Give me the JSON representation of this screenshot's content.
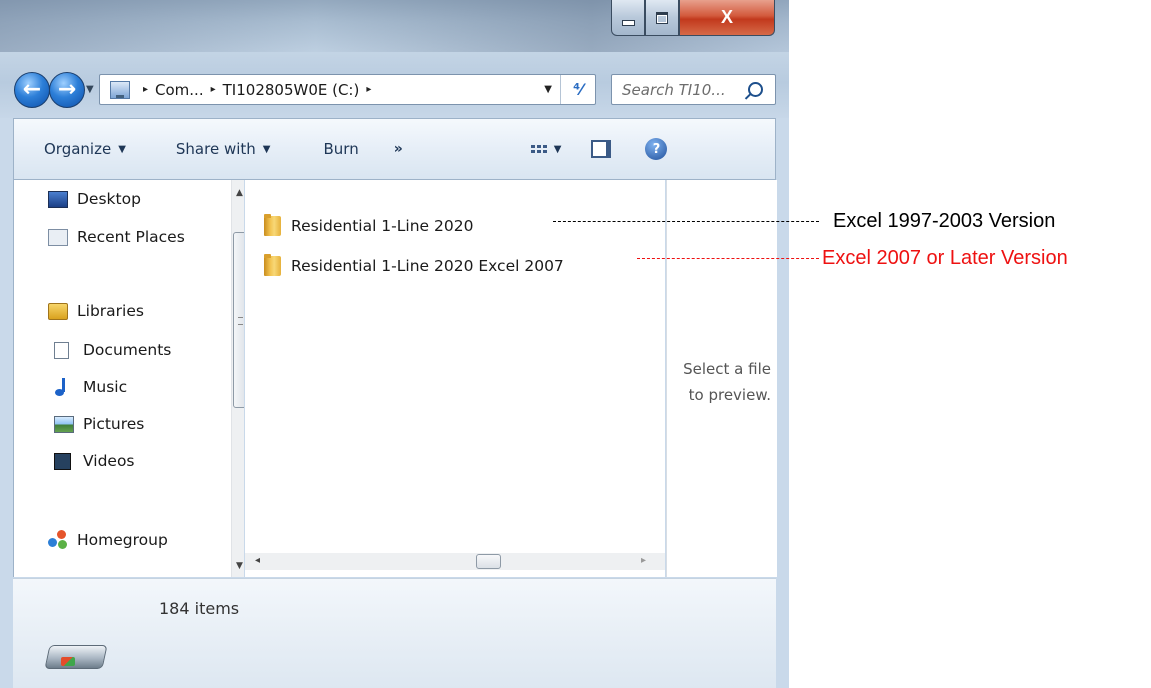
{
  "window": {
    "caption_buttons": {
      "close_glyph": "X"
    },
    "accent_color": "#2d7fd8"
  },
  "navigation": {
    "back_glyph": "←",
    "forward_glyph": "→",
    "history_glyph": "▼"
  },
  "address_bar": {
    "crumbs": [
      "Com...",
      "TI102805W0E (C:)"
    ],
    "separator": "▸",
    "dropdown_glyph": "▼",
    "refresh_glyph": "⁴⁄"
  },
  "search": {
    "placeholder": "Search TI10..."
  },
  "toolbar": {
    "organize": "Organize",
    "share_with": "Share with",
    "burn": "Burn",
    "more": "»",
    "caret": "▼",
    "help_glyph": "?"
  },
  "nav_pane": {
    "items": [
      {
        "label": "Desktop",
        "icon": "desktop-icon"
      },
      {
        "label": "Recent Places",
        "icon": "recent-places-icon"
      },
      {
        "label": "Libraries",
        "icon": "libraries-icon"
      },
      {
        "label": "Documents",
        "icon": "documents-icon"
      },
      {
        "label": "Music",
        "icon": "music-icon"
      },
      {
        "label": "Pictures",
        "icon": "pictures-icon"
      },
      {
        "label": "Videos",
        "icon": "videos-icon"
      },
      {
        "label": "Homegroup",
        "icon": "homegroup-icon"
      }
    ],
    "scroll_up": "▲",
    "scroll_down": "▼"
  },
  "content": {
    "files": [
      {
        "name": "Residential 1-Line 2020",
        "icon": "folder-icon"
      },
      {
        "name": "Residential 1-Line 2020 Excel 2007",
        "icon": "folder-icon"
      }
    ],
    "scroll_left": "◂",
    "scroll_right": "▸"
  },
  "preview": {
    "line1": "Select a file",
    "line2": "to preview."
  },
  "details": {
    "item_count": "184 items"
  },
  "annotations": [
    {
      "text": "Excel 1997-2003 Version",
      "color": "#000000"
    },
    {
      "text": "Excel 2007 or Later Version",
      "color": "#ee1111"
    }
  ]
}
